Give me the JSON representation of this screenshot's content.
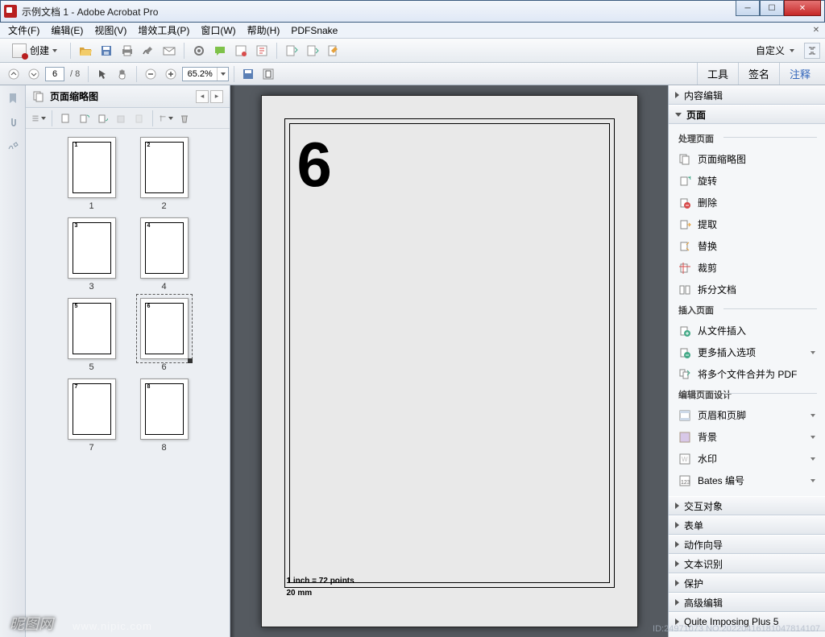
{
  "window": {
    "title": "示例文档 1 - Adobe Acrobat Pro"
  },
  "menu": {
    "items": [
      "文件(F)",
      "编辑(E)",
      "视图(V)",
      "增效工具(P)",
      "窗口(W)",
      "帮助(H)",
      "PDFSnake"
    ]
  },
  "toolbar1": {
    "create": "创建",
    "customize": "自定义"
  },
  "toolbar2": {
    "page_current": "6",
    "page_total": "/ 8",
    "zoom": "65.2%",
    "tabs": {
      "tools": "工具",
      "sign": "签名",
      "comment": "注释"
    }
  },
  "thumbnails": {
    "title": "页面缩略图",
    "pages": [
      1,
      2,
      3,
      4,
      5,
      6,
      7,
      8
    ],
    "selected": 6
  },
  "document": {
    "big_number": "6",
    "inch_line": "1 inch = 72 points",
    "mm_line": "20 mm"
  },
  "rightpanel": {
    "sections": {
      "content_edit": "内容编辑",
      "pages": "页面",
      "interactive": "交互对象",
      "forms": "表单",
      "actions": "动作向导",
      "ocr": "文本识别",
      "protect": "保护",
      "advanced_edit": "高级编辑",
      "quite": "Quite Imposing Plus 5"
    },
    "pages_group": {
      "process_header": "处理页面",
      "thumbnails": "页面缩略图",
      "rotate": "旋转",
      "delete": "删除",
      "extract": "提取",
      "replace": "替换",
      "crop": "裁剪",
      "split": "拆分文档",
      "insert_header": "插入页面",
      "from_file": "从文件插入",
      "more_insert": "更多插入选项",
      "combine": "将多个文件合并为 PDF",
      "design_header": "编辑页面设计",
      "header_footer": "页眉和页脚",
      "background": "背景",
      "watermark": "水印",
      "bates": "Bates 编号"
    }
  },
  "watermark": {
    "logo": "昵图网",
    "url": "www.nipic.com",
    "id": "ID:24971073 NO:20220416181047814107"
  }
}
